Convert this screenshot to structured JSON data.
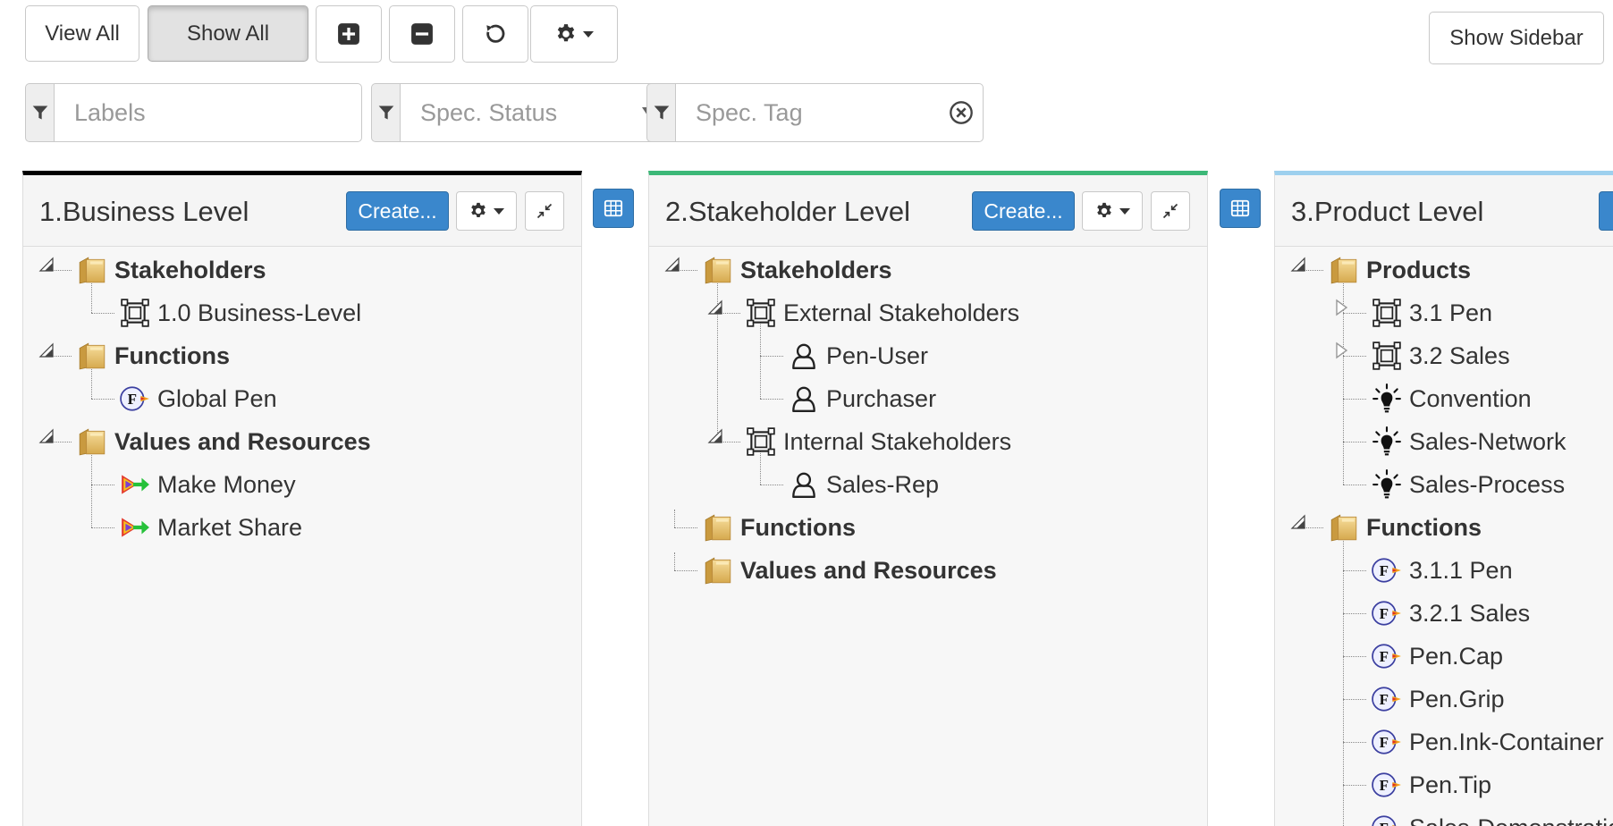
{
  "toolbar": {
    "view_all": "View All",
    "show_all": "Show All",
    "show_sidebar": "Show Sidebar"
  },
  "filters": {
    "labels_placeholder": "Labels",
    "status_placeholder": "Spec. Status",
    "tag_placeholder": "Spec. Tag"
  },
  "colors": {
    "primary": "#3a87cc",
    "panel1_accent": "#000000",
    "panel2_accent": "#3cb878",
    "panel3_accent": "#9dd0ee"
  },
  "panels": [
    {
      "title": "1.Business Level",
      "create_label": "Create...",
      "nodes": [
        {
          "label": "Stakeholders",
          "icon": "folder-icon",
          "bold": true
        },
        {
          "label": "1.0 Business-Level",
          "icon": "frame-icon"
        },
        {
          "label": "Functions",
          "icon": "folder-icon",
          "bold": true
        },
        {
          "label": "Global Pen",
          "icon": "function-icon"
        },
        {
          "label": "Values and Resources",
          "icon": "folder-icon",
          "bold": true
        },
        {
          "label": "Make Money",
          "icon": "goal-arrow-icon"
        },
        {
          "label": "Market Share",
          "icon": "goal-arrow-icon"
        }
      ]
    },
    {
      "title": "2.Stakeholder Level",
      "create_label": "Create...",
      "nodes": [
        {
          "label": "Stakeholders",
          "icon": "folder-icon",
          "bold": true
        },
        {
          "label": "External Stakeholders",
          "icon": "frame-icon"
        },
        {
          "label": "Pen-User",
          "icon": "user-icon"
        },
        {
          "label": "Purchaser",
          "icon": "user-icon"
        },
        {
          "label": "Internal Stakeholders",
          "icon": "frame-icon"
        },
        {
          "label": "Sales-Rep",
          "icon": "user-icon"
        },
        {
          "label": "Functions",
          "icon": "folder-icon",
          "bold": true
        },
        {
          "label": "Values and Resources",
          "icon": "folder-icon",
          "bold": true
        }
      ]
    },
    {
      "title": "3.Product Level",
      "nodes": [
        {
          "label": "Products",
          "icon": "folder-icon",
          "bold": true
        },
        {
          "label": "3.1 Pen",
          "icon": "frame-icon"
        },
        {
          "label": "3.2 Sales",
          "icon": "frame-icon"
        },
        {
          "label": "Convention",
          "icon": "lightbulb-icon"
        },
        {
          "label": "Sales-Network",
          "icon": "lightbulb-icon"
        },
        {
          "label": "Sales-Process",
          "icon": "lightbulb-icon"
        },
        {
          "label": "Functions",
          "icon": "folder-icon",
          "bold": true
        },
        {
          "label": "3.1.1 Pen",
          "icon": "function-icon"
        },
        {
          "label": "3.2.1 Sales",
          "icon": "function-icon"
        },
        {
          "label": "Pen.Cap",
          "icon": "function-icon"
        },
        {
          "label": "Pen.Grip",
          "icon": "function-icon"
        },
        {
          "label": "Pen.Ink-Container",
          "icon": "function-icon"
        },
        {
          "label": "Pen.Tip",
          "icon": "function-icon"
        },
        {
          "label": "Sales-Demonstration",
          "icon": "function-icon"
        }
      ]
    }
  ]
}
